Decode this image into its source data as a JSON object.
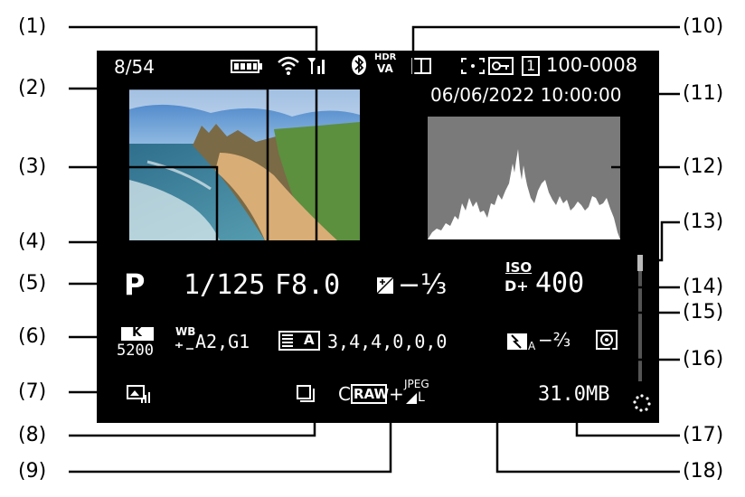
{
  "screen": {
    "image_counter": "8/54",
    "date_time": "06/06/2022 10:00:00",
    "folder_file": "100-0008",
    "card_icon_text": "1",
    "hdr_label_top": "HDR",
    "hdr_label_bottom": "VA",
    "shooting_mode": "P",
    "shutter_speed": "1/125",
    "aperture": "F8.0",
    "exposure_comp": "−⅓",
    "iso_label": "ISO",
    "iso_value": "400",
    "d_plus": "D+",
    "wb_label": "WB",
    "wb_correction": "A2,G1",
    "kelvin_icon_text": "K",
    "color_temp": "5200",
    "picture_style_icon_text": "A",
    "picture_style_values": "3,4,4,0,0,0",
    "flash_comp": "−⅔",
    "flash_comp_suffix": "A",
    "image_quality_prefix": "C",
    "raw_label": "RAW",
    "plus": "+",
    "jpeg_label": "JPEG",
    "jpeg_size": "L",
    "file_size": "31.0MB"
  },
  "callouts": {
    "c1": "(1)",
    "c2": "(2)",
    "c3": "(3)",
    "c4": "(4)",
    "c5": "(5)",
    "c6": "(6)",
    "c7": "(7)",
    "c8": "(8)",
    "c9": "(9)",
    "c10": "(10)",
    "c11": "(11)",
    "c12": "(12)",
    "c13": "(13)",
    "c14": "(14)",
    "c15": "(15)",
    "c16": "(16)",
    "c17": "(17)",
    "c18": "(18)"
  },
  "colors": {
    "screen_bg": "#000000",
    "histogram_bg": "#7a7a7a",
    "histogram_fill": "#ffffff"
  },
  "icons": [
    "battery-icon",
    "wifi-icon",
    "signal-icon",
    "bluetooth-icon",
    "hdr-icon",
    "frame-icon",
    "af-point-icon",
    "protect-icon",
    "card-icon",
    "wb-shift-icon",
    "picture-style-icon",
    "exposure-comp-icon",
    "flash-comp-icon",
    "metering-icon",
    "drive-mode-icon",
    "creative-filter-icon",
    "busy-icon"
  ]
}
